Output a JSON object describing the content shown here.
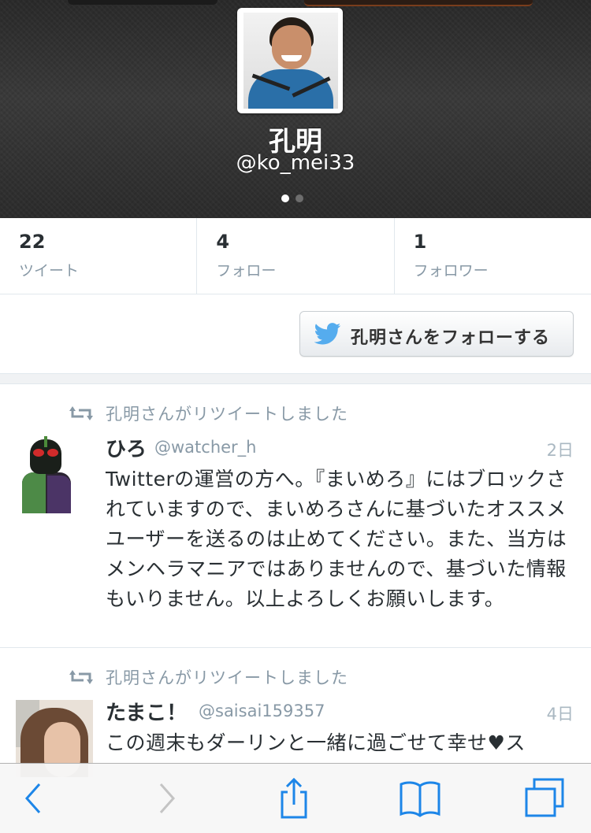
{
  "profile": {
    "display_name": "孔明",
    "username": "@ko_mei33",
    "page_indicator": {
      "total": 2,
      "current": 1
    }
  },
  "stats": [
    {
      "value": "22",
      "label": "ツイート"
    },
    {
      "value": "4",
      "label": "フォロー"
    },
    {
      "value": "1",
      "label": "フォロワー"
    }
  ],
  "follow_button": {
    "label": "孔明さんをフォローする",
    "icon": "twitter-bird-icon"
  },
  "tweets": [
    {
      "retweet_notice": "孔明さんがリツイートしました",
      "name": "ひろ",
      "handle": "@watcher_h",
      "time": "2日",
      "text": "Twitterの運営の方へ。『まいめろ』にはブロックされていますので、まいめろさんに基づいたオススメユーザーを送るのは止めてください。また、当方はメンヘラマニアではありませんので、基づいた情報もいりません。以上よろしくお願いします。"
    },
    {
      "retweet_notice": "孔明さんがリツイートしました",
      "name": "たまこ！",
      "handle": "@saisai159357",
      "time": "4日",
      "text": "この週末もダーリンと一緒に過ごせて幸せ♥ス"
    }
  ],
  "toolbar": {
    "items": [
      "back-icon",
      "forward-icon",
      "share-icon",
      "bookmarks-icon",
      "tabs-icon"
    ],
    "accent": "#1d86e8",
    "disabled": "#c4c4c4"
  },
  "colors": {
    "twitter_blue": "#55acee",
    "muted_text": "#8899a6",
    "header_bg": "#2e2e2e"
  }
}
